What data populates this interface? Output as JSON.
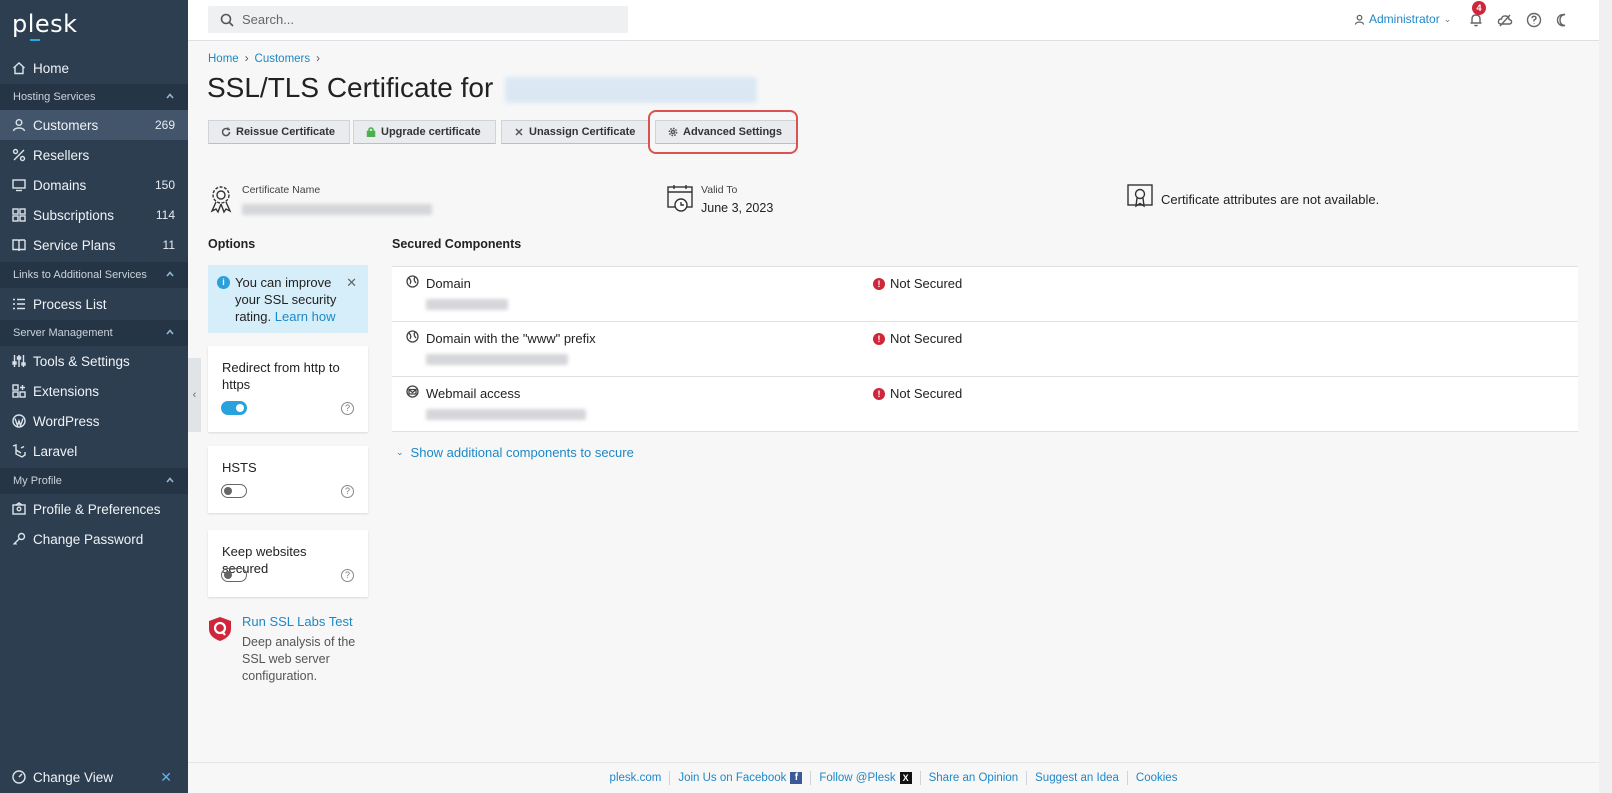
{
  "app": {
    "logo": "plesk"
  },
  "sidebar": {
    "home": "Home",
    "sections": {
      "hosting": "Hosting Services",
      "links": "Links to Additional Services",
      "server": "Server Management",
      "profile": "My Profile"
    },
    "items": {
      "customers": {
        "label": "Customers",
        "count": "269"
      },
      "resellers": {
        "label": "Resellers"
      },
      "domains": {
        "label": "Domains",
        "count": "150"
      },
      "subscriptions": {
        "label": "Subscriptions",
        "count": "114"
      },
      "service_plans": {
        "label": "Service Plans",
        "count": "11"
      },
      "process_list": {
        "label": "Process List"
      },
      "tools_settings": {
        "label": "Tools & Settings"
      },
      "extensions": {
        "label": "Extensions"
      },
      "wordpress": {
        "label": "WordPress"
      },
      "laravel": {
        "label": "Laravel"
      },
      "profile_prefs": {
        "label": "Profile & Preferences"
      },
      "change_password": {
        "label": "Change Password"
      }
    },
    "change_view": "Change View"
  },
  "topbar": {
    "search_placeholder": "Search...",
    "user": "Administrator",
    "notifications_count": "4"
  },
  "breadcrumb": {
    "home": "Home",
    "customers": "Customers"
  },
  "page": {
    "title": "SSL/TLS Certificate for"
  },
  "toolbar": {
    "reissue": "Reissue Certificate",
    "upgrade": "Upgrade certificate",
    "unassign": "Unassign Certificate",
    "advanced": "Advanced Settings"
  },
  "cert": {
    "name_label": "Certificate Name",
    "valid_label": "Valid To",
    "valid_value": "June 3, 2023",
    "attributes_text": "Certificate attributes are not available."
  },
  "options": {
    "title": "Options",
    "tip_text": "You can improve your SSL security rating.",
    "tip_link": "Learn how",
    "redirect": {
      "label": "Redirect from http to https",
      "enabled": true
    },
    "hsts": {
      "label": "HSTS",
      "enabled": false
    },
    "keep_secured": {
      "label": "Keep websites secured",
      "enabled": false
    },
    "ssl_labs_link": "Run SSL Labs Test",
    "ssl_labs_desc": "Deep analysis of the SSL web server configuration."
  },
  "components": {
    "title": "Secured Components",
    "rows": [
      {
        "name": "Domain",
        "status": "Not Secured"
      },
      {
        "name": "Domain with the \"www\" prefix",
        "status": "Not Secured"
      },
      {
        "name": "Webmail access",
        "status": "Not Secured"
      }
    ],
    "show_more": "Show additional components to secure"
  },
  "footer": {
    "links": [
      "plesk.com",
      "Join Us on Facebook",
      "Follow @Plesk",
      "Share an Opinion",
      "Suggest an Idea",
      "Cookies"
    ]
  },
  "colors": {
    "accent": "#1e88c7",
    "sidebar": "#2d3e50",
    "danger": "#d0263b",
    "highlight": "#d9534f"
  }
}
